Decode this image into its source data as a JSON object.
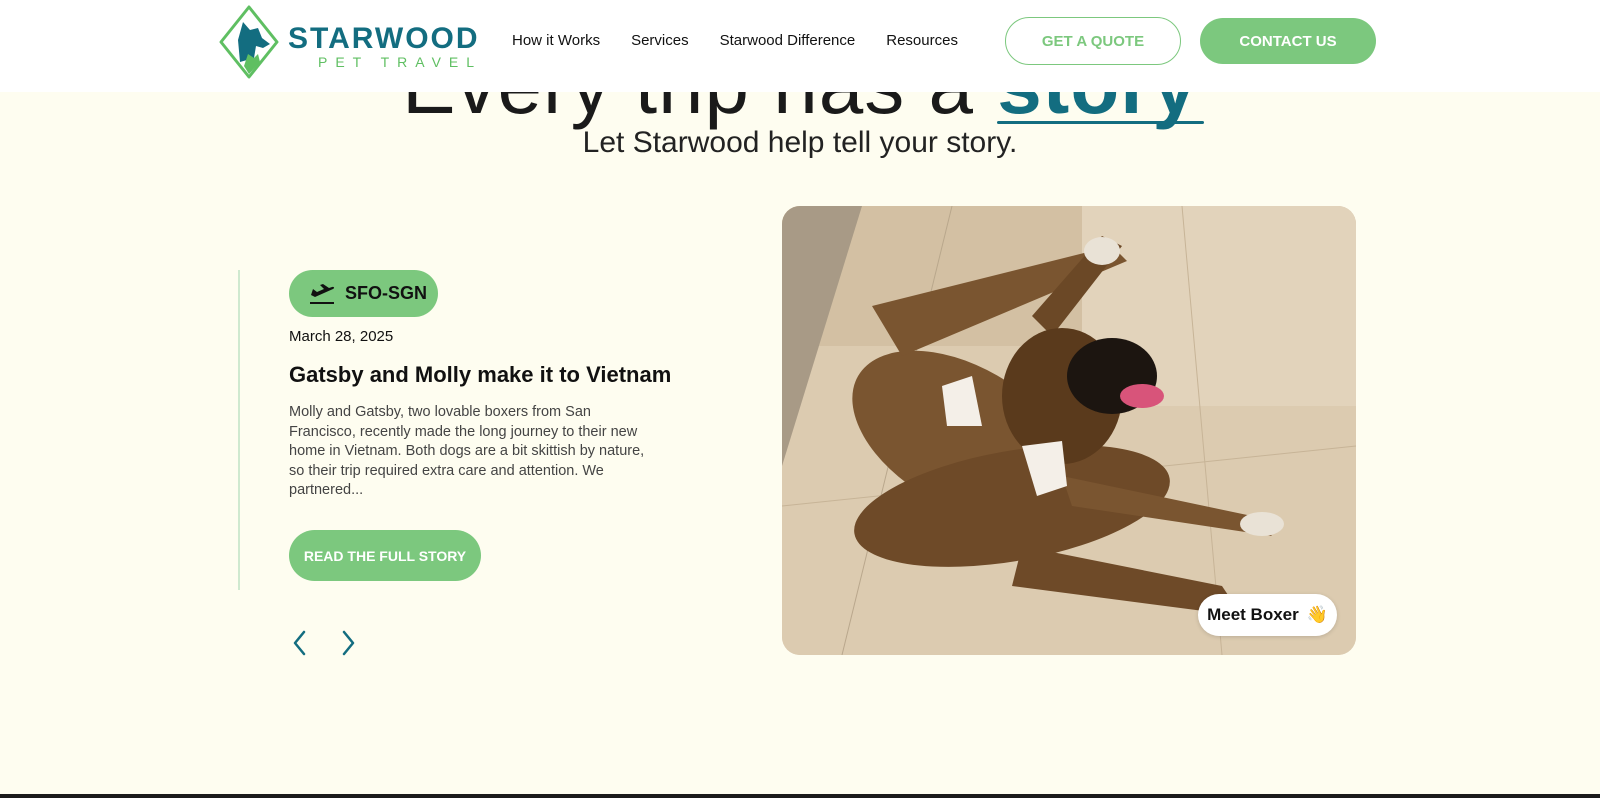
{
  "header": {
    "logo": {
      "wordmark": "STARWOOD",
      "tagline": "PET TRAVEL"
    },
    "nav": [
      "How it Works",
      "Services",
      "Starwood Difference",
      "Resources"
    ],
    "quote_button": "GET A QUOTE",
    "contact_button": "CONTACT US"
  },
  "hero": {
    "title_prefix": "Every trip has a",
    "title_accent": "story",
    "subtitle": "Let Starwood help tell your story."
  },
  "story": {
    "route": "SFO-SGN",
    "route_icon": "plane-departure-icon",
    "date": "March 28, 2025",
    "title": "Gatsby and Molly make it to Vietnam",
    "excerpt": "Molly and Gatsby, two lovable boxers from San Francisco, recently made the long journey to their new home in Vietnam. Both dogs are a bit skittish by nature, so their trip required extra care and attention. We partnered...",
    "read_button": "READ THE FULL STORY",
    "prev_icon": "chevron-left-icon",
    "next_icon": "chevron-right-icon"
  },
  "photo": {
    "badge_text": "Meet Boxer",
    "badge_emoji": "👋"
  },
  "colors": {
    "brand_teal": "#136d80",
    "brand_green": "#7cc87e",
    "page_background": "#fefdf0"
  }
}
